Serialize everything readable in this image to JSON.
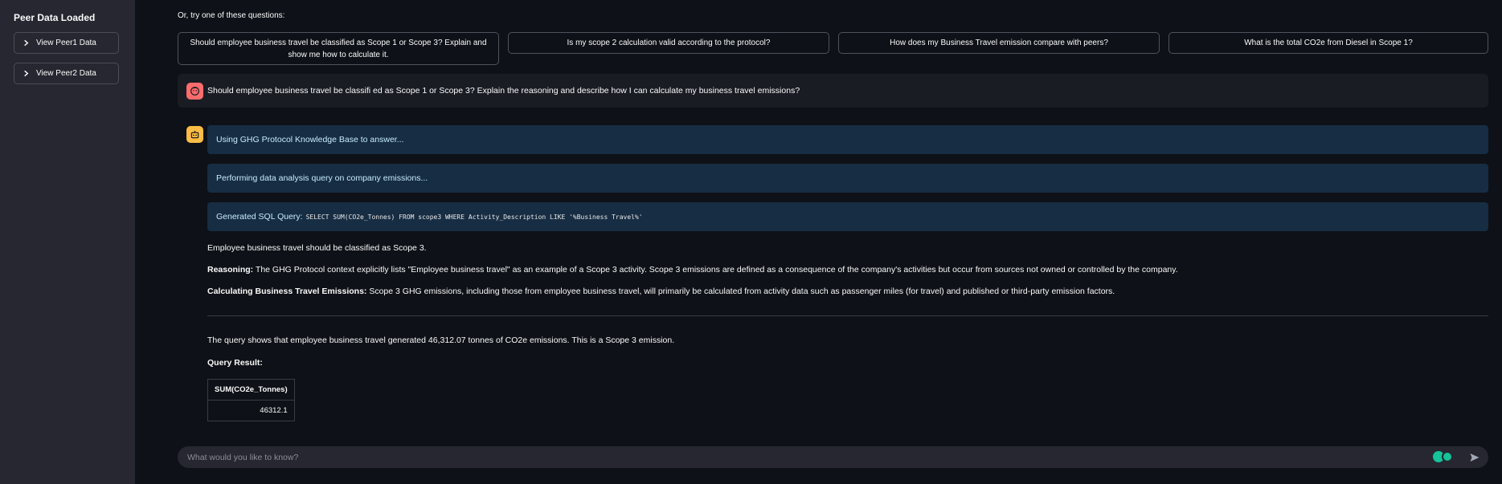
{
  "sidebar": {
    "title": "Peer Data Loaded",
    "expanders": [
      {
        "label": "View Peer1 Data"
      },
      {
        "label": "View Peer2 Data"
      }
    ]
  },
  "suggestions": {
    "intro": "Or, try one of these questions:",
    "items": [
      {
        "label": "Should employee business travel be classified as Scope 1 or Scope 3? Explain and show me how to calculate it."
      },
      {
        "label": "Is my scope 2 calculation valid according to the protocol?"
      },
      {
        "label": "How does my Business Travel emission compare with peers?"
      },
      {
        "label": "What is the total CO2e from Diesel in Scope 1?"
      }
    ]
  },
  "user_message": {
    "text": "Should employee business travel be classifi ed as Scope 1 or Scope 3? Explain the reasoning and describe how I can calculate my business travel emissions?"
  },
  "assistant": {
    "status": [
      {
        "text": "Using GHG Protocol Knowledge Base to answer..."
      },
      {
        "text": "Performing data analysis query on company emissions..."
      }
    ],
    "sql": {
      "label": "Generated SQL Query:",
      "code": "SELECT SUM(CO2e_Tonnes) FROM scope3 WHERE Activity_Description LIKE '%Business Travel%'"
    },
    "answer": "Employee business travel should be classified as Scope 3.",
    "reasoning_label": "Reasoning:",
    "reasoning": "The GHG Protocol context explicitly lists \"Employee business travel\" as an example of a Scope 3 activity. Scope 3 emissions are defined as a consequence of the company's activities but occur from sources not owned or controlled by the company.",
    "calc_label": "Calculating Business Travel Emissions:",
    "calc": "Scope 3 GHG emissions, including those from employee business travel, will primarily be calculated from activity data such as passenger miles (for travel) and published or third-party emission factors.",
    "query_summary": "The query shows that employee business travel generated 46,312.07 tonnes of CO2e emissions. This is a Scope 3 emission.",
    "query_result_label": "Query Result:",
    "table": {
      "header": "SUM(CO2e_Tonnes)",
      "value": "46312.1"
    }
  },
  "chat_input": {
    "placeholder": "What would you like to know?"
  },
  "colors": {
    "background": "#0e1117",
    "sidebar": "#262730",
    "status_bg": "#172d43",
    "user_avatar": "#ff6c6c",
    "bot_avatar": "#ffbd45"
  },
  "icons": [
    "chevron-right-icon",
    "user-face-icon",
    "robot-icon",
    "send-icon",
    "extension-pin-icon",
    "grammarly-icon"
  ]
}
